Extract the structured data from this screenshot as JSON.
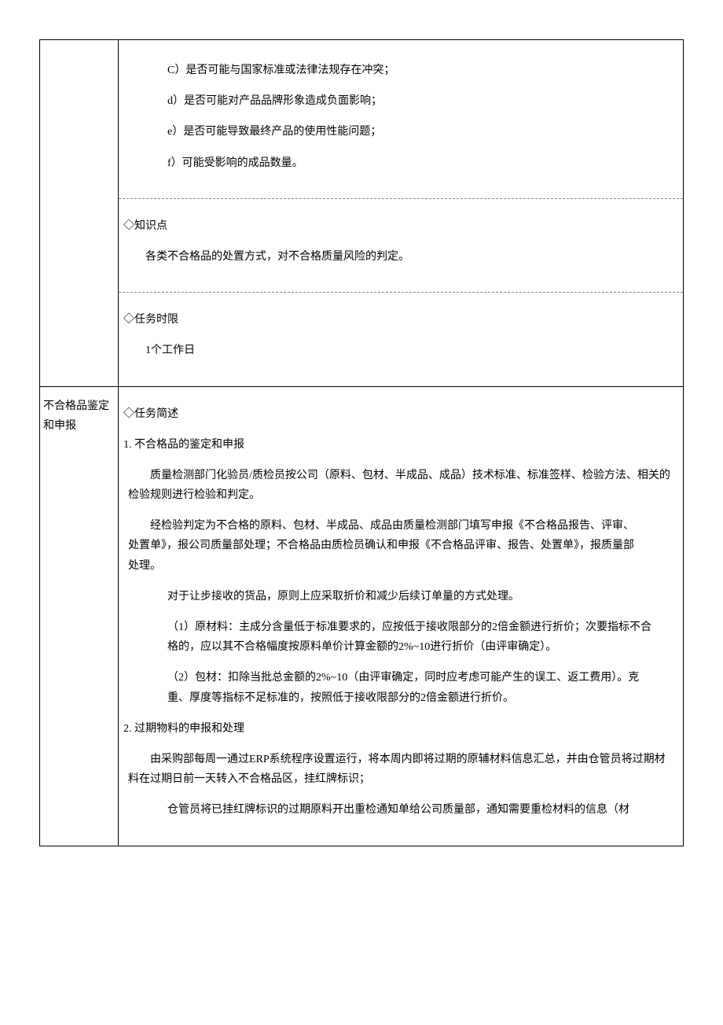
{
  "row1": {
    "label": "",
    "items": {
      "c": "C）是否可能与国家标准或法律法规存在冲突；",
      "d": "d）是否可能对产品品牌形象造成负面影响；",
      "e": "e）是否可能导致最终产品的使用性能问题；",
      "f": "f）可能受影响的成品数量。"
    },
    "knowledge_label": "◇知识点",
    "knowledge_text": "各类不合格品的处置方式，对不合格质量风险的判定。",
    "deadline_label": "◇任务时限",
    "deadline_text": "1个工作日"
  },
  "row2": {
    "label": "不合格品鉴定和申报",
    "brief_label": "◇任务简述",
    "sec1_title": "1. 不合格品的鉴定和申报",
    "sec1_p1": "质量检测部门化验员/质检员按公司（原料、包材、半成品、成品）技术标准、标准签样、检验方法、相关的检验规则进行检验和判定。",
    "sec1_p2": "经检验判定为不合格的原料、包材、半成品、成品由质量检测部门填写申报《不合格品报告、评审、处置单》，报公司质量部处理；不合格品由质检员确认和申报《不合格品评审、报告、处置单》，报质量部处理。",
    "sec1_p3": "对于让步接收的货品，原则上应采取折价和减少后续订单量的方式处理。",
    "sec1_p4": "（1）原材料：主成分含量低于标准要求的，应按低于接收限部分的2倍金额进行折价；次要指标不合格的，应以其不合格幅度按原料单价计算金额的2%~10进行折价（由评审确定）。",
    "sec1_p5": "（2）包材：扣除当批总金额的2%~10（由评审确定，同时应考虑可能产生的误工、返工费用）。克重、厚度等指标不足标准的，按照低于接收限部分的2倍金额进行折价。",
    "sec2_title": "2.  过期物料的申报和处理",
    "sec2_p1": "由采购部每周一通过ERP系统程序设置运行，将本周内即将过期的原辅材料信息汇总，并由仓管员将过期材料在过期日前一天转入不合格品区，挂红牌标识；",
    "sec2_p2": "仓管员将已挂红牌标识的过期原料开出重检通知单给公司质量部，通知需要重检材料的信息（材"
  }
}
